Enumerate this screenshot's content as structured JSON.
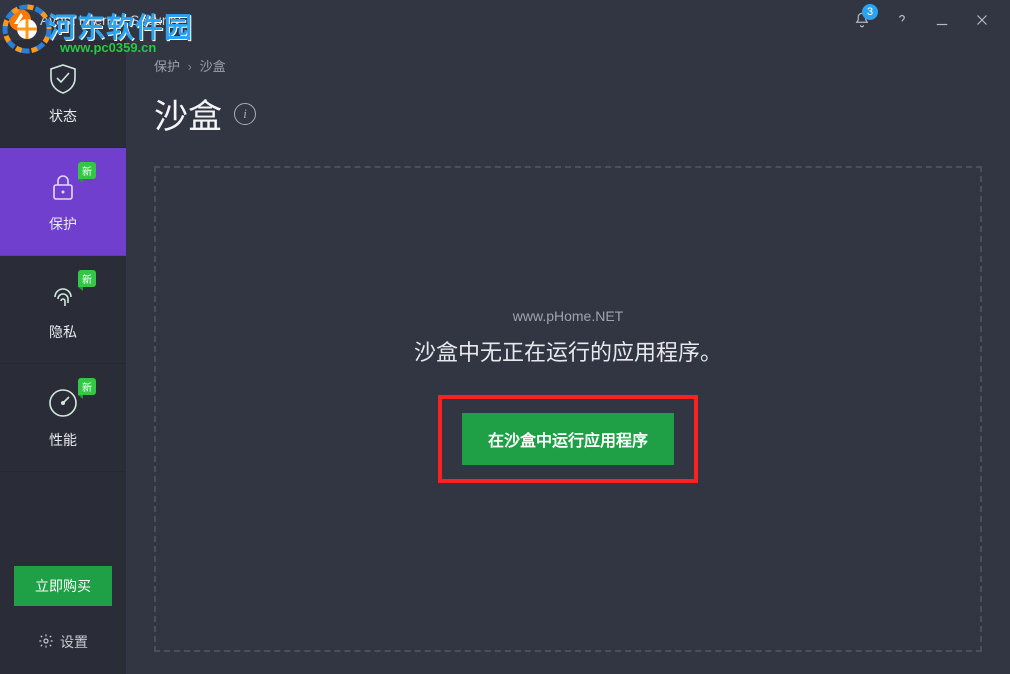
{
  "titlebar": {
    "app_name": "Avast Internet Security",
    "notification_count": "3"
  },
  "watermark": {
    "cn_text": "河东软件园",
    "url_text": "www.pc0359.cn"
  },
  "sidebar": {
    "items": [
      {
        "label": "状态",
        "icon": "shield",
        "badge": ""
      },
      {
        "label": "保护",
        "icon": "lock",
        "badge": "新"
      },
      {
        "label": "隐私",
        "icon": "fingerprint",
        "badge": "新"
      },
      {
        "label": "性能",
        "icon": "gauge",
        "badge": "新"
      }
    ],
    "buy_label": "立即购买",
    "settings_label": "设置"
  },
  "main": {
    "breadcrumb_parent": "保护",
    "breadcrumb_current": "沙盒",
    "title": "沙盒",
    "watermark2": "www.pHome.NET",
    "empty_message": "沙盒中无正在运行的应用程序。",
    "run_button_label": "在沙盒中运行应用程序"
  }
}
